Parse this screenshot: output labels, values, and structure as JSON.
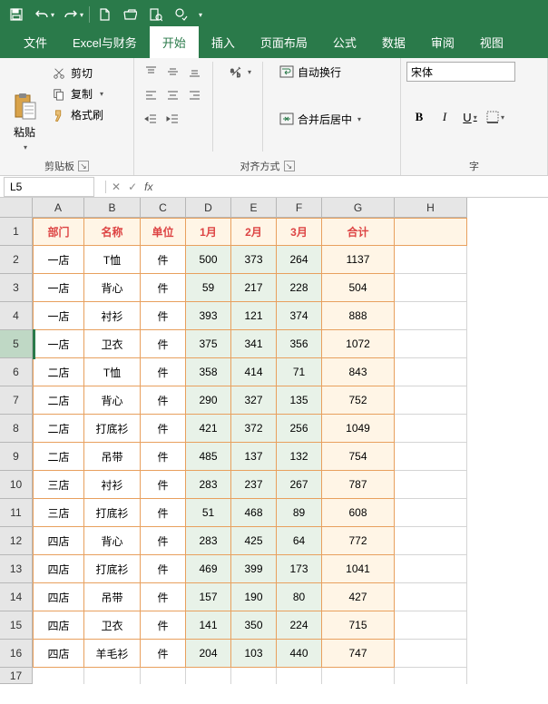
{
  "qat": {
    "dropdown_glyph": "▾"
  },
  "tabs": [
    "文件",
    "Excel与财务",
    "开始",
    "插入",
    "页面布局",
    "公式",
    "数据",
    "审阅",
    "视图"
  ],
  "active_tab_index": 2,
  "ribbon": {
    "clipboard": {
      "paste": "粘贴",
      "cut": "剪切",
      "copy": "复制",
      "brush": "格式刷",
      "label": "剪贴板"
    },
    "align": {
      "wrap": "自动换行",
      "merge": "合并后居中",
      "label": "对齐方式"
    },
    "font": {
      "name": "宋体",
      "bold": "B",
      "italic": "I",
      "under": "U",
      "label": "字"
    }
  },
  "formula": {
    "cell_ref": "L5",
    "cancel": "✕",
    "check": "✓",
    "fx": "fx",
    "value": ""
  },
  "cols": [
    "A",
    "B",
    "C",
    "D",
    "E",
    "F",
    "G",
    "H"
  ],
  "col_widths": [
    "cA",
    "cB",
    "cC",
    "cD",
    "cE",
    "cF",
    "cG",
    "cH"
  ],
  "row_numbers": [
    "1",
    "2",
    "3",
    "4",
    "5",
    "6",
    "7",
    "8",
    "9",
    "10",
    "11",
    "12",
    "13",
    "14",
    "15",
    "16",
    "17"
  ],
  "header": [
    "部门",
    "名称",
    "单位",
    "1月",
    "2月",
    "3月",
    "合计"
  ],
  "rows": [
    [
      "一店",
      "T恤",
      "件",
      "500",
      "373",
      "264",
      "1137"
    ],
    [
      "一店",
      "背心",
      "件",
      "59",
      "217",
      "228",
      "504"
    ],
    [
      "一店",
      "衬衫",
      "件",
      "393",
      "121",
      "374",
      "888"
    ],
    [
      "一店",
      "卫衣",
      "件",
      "375",
      "341",
      "356",
      "1072"
    ],
    [
      "二店",
      "T恤",
      "件",
      "358",
      "414",
      "71",
      "843"
    ],
    [
      "二店",
      "背心",
      "件",
      "290",
      "327",
      "135",
      "752"
    ],
    [
      "二店",
      "打底衫",
      "件",
      "421",
      "372",
      "256",
      "1049"
    ],
    [
      "二店",
      "吊带",
      "件",
      "485",
      "137",
      "132",
      "754"
    ],
    [
      "三店",
      "衬衫",
      "件",
      "283",
      "237",
      "267",
      "787"
    ],
    [
      "三店",
      "打底衫",
      "件",
      "51",
      "468",
      "89",
      "608"
    ],
    [
      "四店",
      "背心",
      "件",
      "283",
      "425",
      "64",
      "772"
    ],
    [
      "四店",
      "打底衫",
      "件",
      "469",
      "399",
      "173",
      "1041"
    ],
    [
      "四店",
      "吊带",
      "件",
      "157",
      "190",
      "80",
      "427"
    ],
    [
      "四店",
      "卫衣",
      "件",
      "141",
      "350",
      "224",
      "715"
    ],
    [
      "四店",
      "羊毛衫",
      "件",
      "204",
      "103",
      "440",
      "747"
    ]
  ],
  "selected_row": 5
}
